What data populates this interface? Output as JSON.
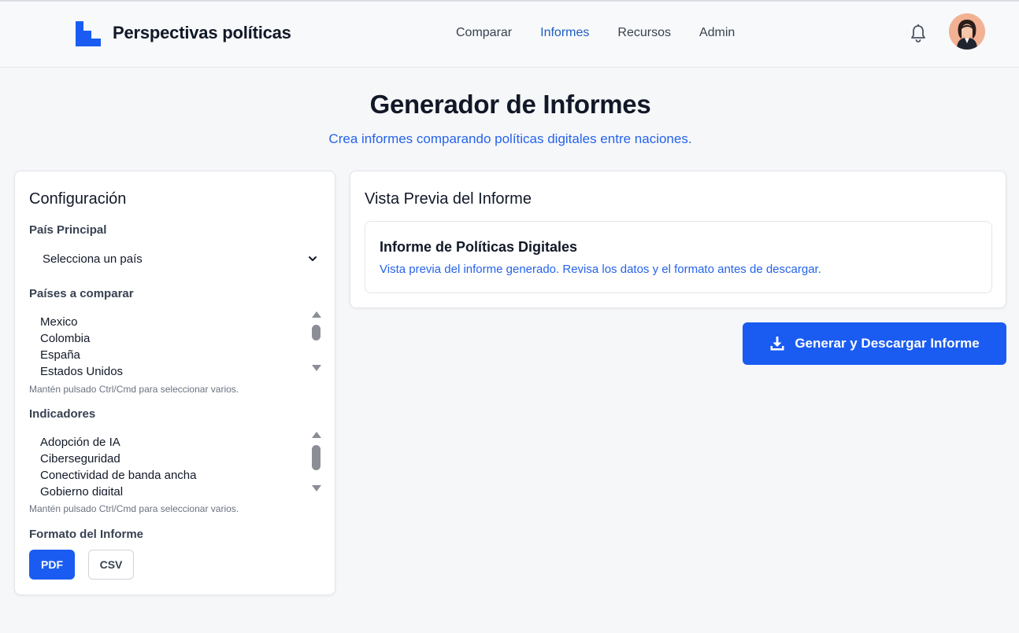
{
  "header": {
    "brand": "Perspectivas políticas",
    "nav": [
      {
        "label": "Comparar"
      },
      {
        "label": "Informes",
        "active": true
      },
      {
        "label": "Recursos"
      },
      {
        "label": "Admin"
      }
    ],
    "icons": {
      "logo": "logo-icon",
      "notifications": "bell-icon",
      "avatar": "user-avatar"
    }
  },
  "page": {
    "title": "Generador de Informes",
    "subtitle": "Crea informes comparando políticas digitales entre naciones."
  },
  "config": {
    "title": "Configuración",
    "main_country": {
      "label": "País Principal",
      "selected": "Selecciona un país"
    },
    "compare_countries": {
      "label": "Países a comparar",
      "options": [
        "Mexico",
        "Colombia",
        "España",
        "Estados Unidos"
      ],
      "hint": "Mantén pulsado Ctrl/Cmd para seleccionar varios."
    },
    "indicators": {
      "label": "Indicadores",
      "options": [
        "Adopción de IA",
        "Ciberseguridad",
        "Conectividad de banda ancha",
        "Gobierno digital"
      ],
      "hint": "Mantén pulsado Ctrl/Cmd para seleccionar varios."
    },
    "format": {
      "label": "Formato del Informe",
      "options": [
        "PDF",
        "CSV"
      ],
      "selected": "PDF"
    }
  },
  "preview": {
    "title": "Vista Previa del Informe",
    "report_title": "Informe de Políticas Digitales",
    "report_description": "Vista previa del informe generado. Revisa los datos y el formato antes de descargar."
  },
  "actions": {
    "generate_label": "Generar y Descargar Informe",
    "generate_icon": "download-icon"
  },
  "colors": {
    "accent": "#1a5cf2",
    "link": "#2563eb",
    "active_nav": "#1d5fbf",
    "background": "#f6f7f9"
  }
}
